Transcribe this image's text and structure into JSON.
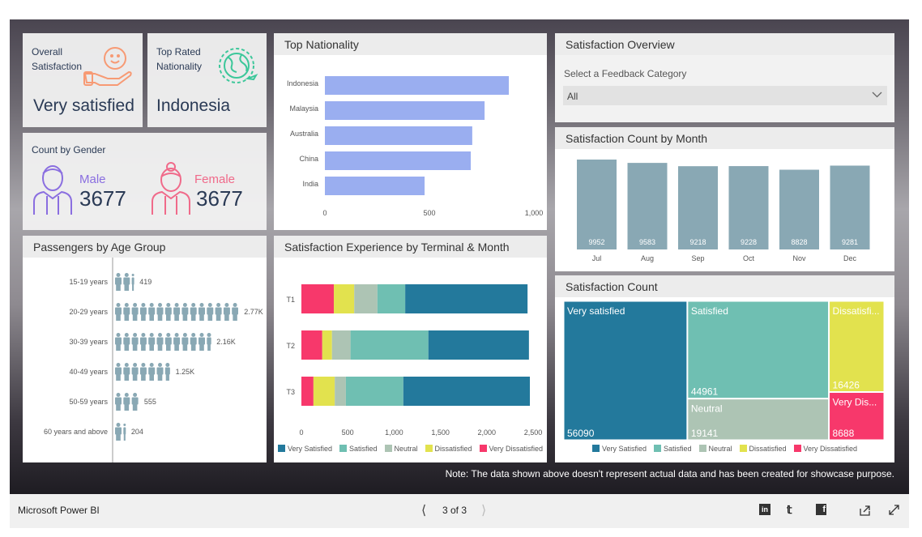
{
  "kpis": {
    "overall": {
      "label": "Overall Satisfaction",
      "value": "Very satisfied",
      "icon": "smile-hand-icon"
    },
    "nationality": {
      "label": "Top Rated Nationality",
      "value": "Indonesia",
      "icon": "globe-plane-icon"
    }
  },
  "gender": {
    "title": "Count by Gender",
    "male": {
      "label": "Male",
      "value": "3677",
      "color": "#8a6ee0"
    },
    "female": {
      "label": "Female",
      "value": "3677",
      "color": "#f06a8a"
    }
  },
  "age": {
    "title": "Passengers by Age Group",
    "rows": [
      {
        "label": "15-19 years",
        "value": 419,
        "display": "419"
      },
      {
        "label": "20-29 years",
        "value": 2770,
        "display": "2.77K"
      },
      {
        "label": "30-39 years",
        "value": 2160,
        "display": "2.16K"
      },
      {
        "label": "40-49 years",
        "value": 1250,
        "display": "1.25K"
      },
      {
        "label": "50-59 years",
        "value": 555,
        "display": "555"
      },
      {
        "label": "60 years and above",
        "value": 204,
        "display": "204"
      }
    ]
  },
  "overview": {
    "title": "Satisfaction Overview",
    "select_label": "Select a Feedback Category",
    "select_value": "All"
  },
  "note": "Note: The data shown above doesn't represent actual data and has been created for showcase purpose.",
  "footer": {
    "brand": "Microsoft Power BI",
    "page": "3 of 3"
  },
  "colors": {
    "Very Satisfied": "#23799c",
    "Satisfied": "#6fbfb2",
    "Neutral": "#adc4b4",
    "Dissatisfied": "#e2e24e",
    "Very Dissatisfied": "#f7386b",
    "bar": "#9aaef0",
    "month_bar": "#89a8b4"
  },
  "chart_data": [
    {
      "id": "nationality",
      "type": "bar",
      "orientation": "horizontal",
      "title": "Top Nationality",
      "categories": [
        "Indonesia",
        "Malaysia",
        "Australia",
        "China",
        "India"
      ],
      "values": [
        880,
        764,
        705,
        698,
        477
      ],
      "xlim": [
        0,
        1000
      ],
      "xticks": [
        "0",
        "500",
        "1,000"
      ]
    },
    {
      "id": "terminal",
      "type": "bar",
      "stacked": true,
      "orientation": "horizontal",
      "title": "Satisfaction Experience by Terminal & Month",
      "categories": [
        "T1",
        "T2",
        "T3"
      ],
      "series": [
        {
          "name": "Very Dissatisfied",
          "values": [
            350,
            225,
            130
          ]
        },
        {
          "name": "Dissatisfied",
          "values": [
            220,
            105,
            230
          ]
        },
        {
          "name": "Neutral",
          "values": [
            250,
            200,
            120
          ]
        },
        {
          "name": "Satisfied",
          "values": [
            300,
            840,
            620
          ]
        },
        {
          "name": "Very Satisfied",
          "values": [
            1320,
            1085,
            1365
          ]
        }
      ],
      "legend_order": [
        "Very Satisfied",
        "Satisfied",
        "Neutral",
        "Dissatisfied",
        "Very Dissatisfied"
      ],
      "xlim": [
        0,
        2500
      ],
      "xticks": [
        "0",
        "500",
        "1,000",
        "1,500",
        "2,000",
        "2,500"
      ],
      "legend": "bottom"
    },
    {
      "id": "month",
      "type": "bar",
      "title": "Satisfaction Count by Month",
      "categories": [
        "Jul",
        "Aug",
        "Sep",
        "Oct",
        "Nov",
        "Dec"
      ],
      "values": [
        9952,
        9583,
        9218,
        9228,
        8828,
        9281
      ]
    },
    {
      "id": "treemap",
      "type": "treemap",
      "title": "Satisfaction Count",
      "items": [
        {
          "name": "Very Satisfied",
          "label": "Very satisfied",
          "value": 56090
        },
        {
          "name": "Satisfied",
          "label": "Satisfied",
          "value": 44961
        },
        {
          "name": "Neutral",
          "label": "Neutral",
          "value": 19141
        },
        {
          "name": "Dissatisfied",
          "label": "Dissatisfi...",
          "value": 16426
        },
        {
          "name": "Very Dissatisfied",
          "label": "Very Dis...",
          "value": 8688
        }
      ],
      "legend": "bottom"
    }
  ]
}
